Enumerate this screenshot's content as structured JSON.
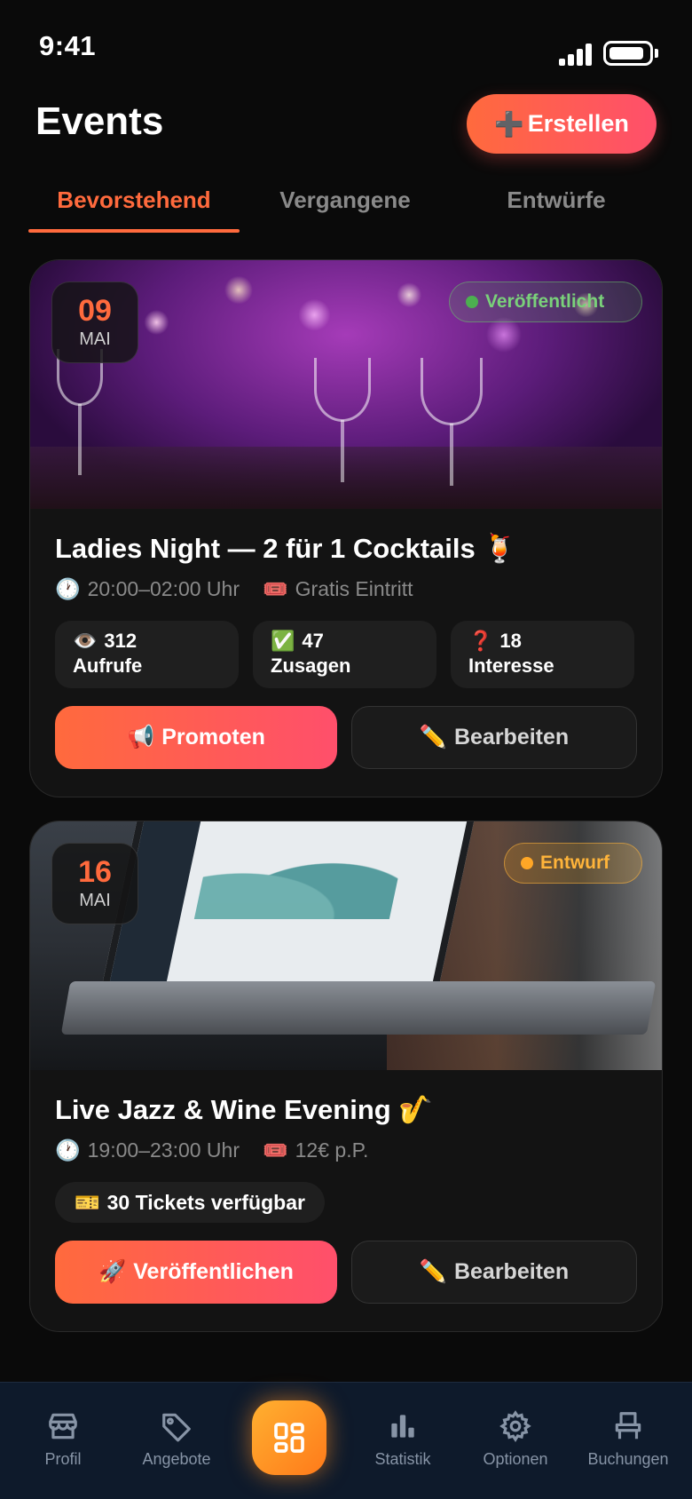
{
  "status_bar": {
    "time": "9:41"
  },
  "header": {
    "title": "Events",
    "create_icon": "➕",
    "create_label": "Erstellen"
  },
  "tabs": [
    {
      "label": "Bevorstehend",
      "active": true
    },
    {
      "label": "Vergangene",
      "active": false
    },
    {
      "label": "Entwürfe",
      "active": false
    }
  ],
  "events": [
    {
      "day": "09",
      "month": "MAI",
      "status": "Veröffentlicht",
      "status_color": "#7ad17a",
      "image": "cocktail-party-photo",
      "title": "Ladies Night — 2 für 1 Cocktails 🍹",
      "time_icon": "🕐",
      "time": "20:00–02:00 Uhr",
      "price_icon": "🎟️",
      "price": "Gratis Eintritt",
      "stats": [
        {
          "icon": "👁️",
          "value": "312",
          "label": "Aufrufe"
        },
        {
          "icon": "✅",
          "value": "47",
          "label": "Zusagen"
        },
        {
          "icon": "❓",
          "value": "18",
          "label": "Interesse"
        }
      ],
      "primary_icon": "📢",
      "primary_label": "Promoten",
      "secondary_icon": "✏️",
      "secondary_label": "Bearbeiten"
    },
    {
      "day": "16",
      "month": "MAI",
      "status": "Entwurf",
      "status_color": "#ffb43a",
      "image": "laptop-dashboard-photo",
      "title": "Live Jazz & Wine Evening 🎷",
      "time_icon": "🕐",
      "time": "19:00–23:00 Uhr",
      "price_icon": "🎟️",
      "price": "12€ p.P.",
      "tickets_icon": "🎫",
      "tickets": "30 Tickets verfügbar",
      "primary_icon": "🚀",
      "primary_label": "Veröffentlichen",
      "secondary_icon": "✏️",
      "secondary_label": "Bearbeiten"
    }
  ],
  "bottom_nav": [
    {
      "label": "Profil",
      "icon": "store-icon"
    },
    {
      "label": "Angebote",
      "icon": "tag-icon"
    },
    {
      "label": "",
      "icon": "dashboard-icon",
      "active": true
    },
    {
      "label": "Statistik",
      "icon": "bar-chart-icon"
    },
    {
      "label": "Optionen",
      "icon": "gear-icon"
    },
    {
      "label": "Buchungen",
      "icon": "chair-icon"
    }
  ],
  "colors": {
    "accent": "#ff6a3d",
    "accent_pink": "#ff4f6b",
    "nav_bg": "#0e1a2b",
    "center_button": "#ff9a1f"
  }
}
